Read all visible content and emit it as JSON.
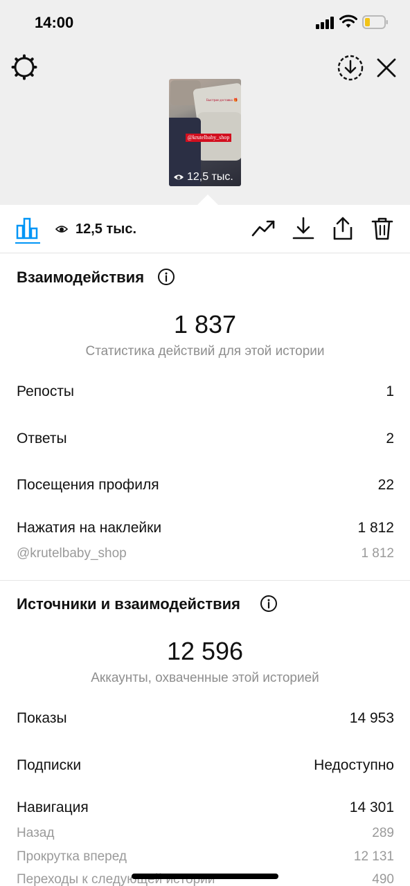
{
  "status_bar": {
    "time": "14:00"
  },
  "story": {
    "caption": "Быстрая доставка 🎁",
    "sticker_text": "@krutelbaby_shop",
    "views": "12,5 тыс."
  },
  "toolbar": {
    "views": "12,5 тыс."
  },
  "interactions": {
    "title": "Взаимодействия",
    "total": "1 837",
    "subtitle": "Статистика действий для этой истории",
    "rows": [
      {
        "label": "Репосты",
        "value": "1"
      },
      {
        "label": "Ответы",
        "value": "2"
      },
      {
        "label": "Посещения профиля",
        "value": "22"
      },
      {
        "label": "Нажатия на наклейки",
        "value": "1 812"
      }
    ],
    "sub_rows": [
      {
        "label": "@krutelbaby_shop",
        "value": "1 812"
      }
    ]
  },
  "discovery": {
    "title": "Источники и взаимодействия",
    "total": "12 596",
    "subtitle": "Аккаунты, охваченные этой историей",
    "rows": [
      {
        "label": "Показы",
        "value": "14 953"
      },
      {
        "label": "Подписки",
        "value": "Недоступно"
      },
      {
        "label": "Навигация",
        "value": "14 301"
      }
    ],
    "sub_rows": [
      {
        "label": "Назад",
        "value": "289"
      },
      {
        "label": "Прокрутка вперед",
        "value": "12 131"
      },
      {
        "label": "Переходы к следующей истории",
        "value": "490"
      }
    ]
  },
  "colors": {
    "accent": "#0095f6",
    "header_bg": "#efefef",
    "muted_text": "#8e8e8e",
    "sticker_red": "#d20f1f"
  }
}
